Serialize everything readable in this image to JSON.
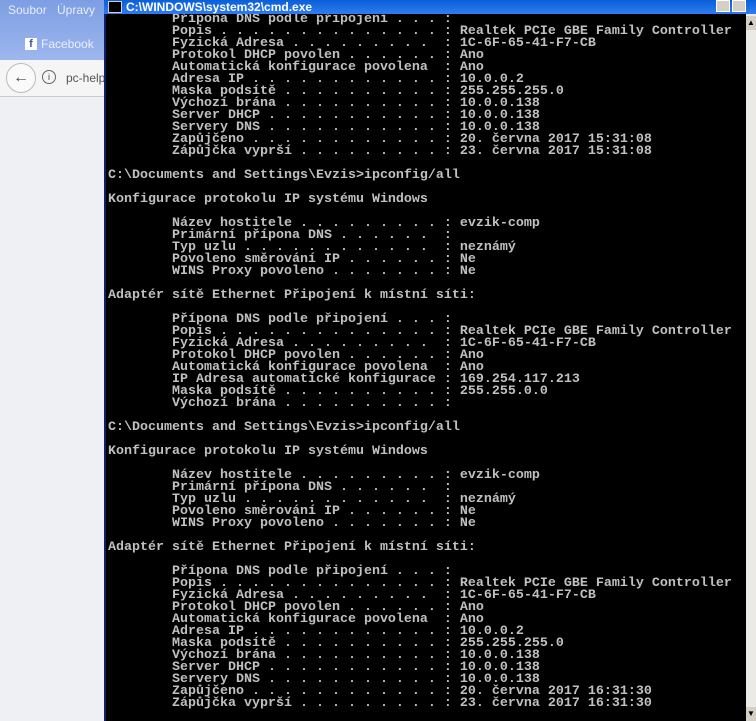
{
  "browser": {
    "menu": [
      "Soubor",
      "Úpravy"
    ],
    "facebook": "Facebook",
    "url": "pc-help"
  },
  "window": {
    "title": "C:\\WINDOWS\\system32\\cmd.exe"
  },
  "console": {
    "prompt": "C:\\Documents and Settings\\Evzis>ipconfig/all",
    "config_header": "Konfigurace protokolu IP systému Windows",
    "adapter_header": "Adaptér sítě Ethernet Připojení k místní síti:",
    "block1": [
      [
        "Přípona DNS podle připojení",
        ""
      ],
      [
        "Popis",
        "Realtek PCIe GBE Family Controller"
      ],
      [
        "Fyzická Adresa",
        "1C-6F-65-41-F7-CB"
      ],
      [
        "Protokol DHCP povolen",
        "Ano"
      ],
      [
        "Automatická konfigurace povolena",
        "Ano"
      ],
      [
        "Adresa IP",
        "10.0.0.2"
      ],
      [
        "Maska podsítě",
        "255.255.255.0"
      ],
      [
        "Výchozí brána",
        "10.0.0.138"
      ],
      [
        "Server DHCP",
        "10.0.0.138"
      ],
      [
        "Servery DNS",
        "10.0.0.138"
      ],
      [
        "Zapůjčeno",
        "20. června 2017 15:31:08"
      ],
      [
        "Zápůjčka vyprší",
        "23. června 2017 15:31:08"
      ]
    ],
    "host1": [
      [
        "Název hostitele",
        "evzik-comp"
      ],
      [
        "Primární přípona DNS",
        ""
      ],
      [
        "Typ uzlu",
        "neznámý"
      ],
      [
        "Povoleno směrování IP",
        "Ne"
      ],
      [
        "WINS Proxy povoleno",
        "Ne"
      ]
    ],
    "block2": [
      [
        "Přípona DNS podle připojení",
        ""
      ],
      [
        "Popis",
        "Realtek PCIe GBE Family Controller"
      ],
      [
        "Fyzická Adresa",
        "1C-6F-65-41-F7-CB"
      ],
      [
        "Protokol DHCP povolen",
        "Ano"
      ],
      [
        "Automatická konfigurace povolena",
        "Ano"
      ],
      [
        "IP Adresa automatické konfigurace",
        "169.254.117.213"
      ],
      [
        "Maska podsítě",
        "255.255.0.0"
      ],
      [
        "Výchozí brána",
        ""
      ]
    ],
    "host2": [
      [
        "Název hostitele",
        "evzik-comp"
      ],
      [
        "Primární přípona DNS",
        ""
      ],
      [
        "Typ uzlu",
        "neznámý"
      ],
      [
        "Povoleno směrování IP",
        "Ne"
      ],
      [
        "WINS Proxy povoleno",
        "Ne"
      ]
    ],
    "block3": [
      [
        "Přípona DNS podle připojení",
        ""
      ],
      [
        "Popis",
        "Realtek PCIe GBE Family Controller"
      ],
      [
        "Fyzická Adresa",
        "1C-6F-65-41-F7-CB"
      ],
      [
        "Protokol DHCP povolen",
        "Ano"
      ],
      [
        "Automatická konfigurace povolena",
        "Ano"
      ],
      [
        "Adresa IP",
        "10.0.0.2"
      ],
      [
        "Maska podsítě",
        "255.255.255.0"
      ],
      [
        "Výchozí brána",
        "10.0.0.138"
      ],
      [
        "Server DHCP",
        "10.0.0.138"
      ],
      [
        "Servery DNS",
        "10.0.0.138"
      ],
      [
        "Zapůjčeno",
        "20. června 2017 16:31:30"
      ],
      [
        "Zápůjčka vyprší",
        "23. června 2017 16:31:30"
      ]
    ]
  }
}
